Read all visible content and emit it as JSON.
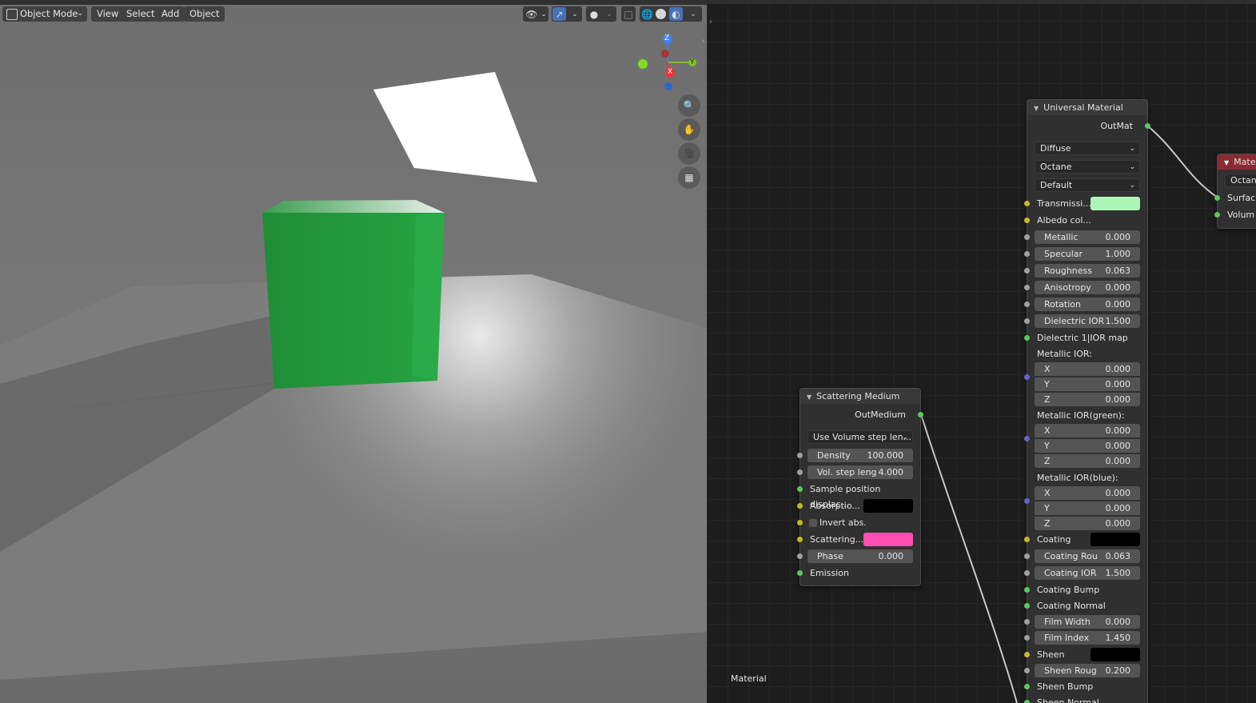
{
  "viewport": {
    "mode_label": "Object Mode",
    "menus": [
      "View",
      "Select",
      "Add",
      "Object"
    ],
    "gizmo": {
      "z": "Z",
      "y": "Y",
      "x": "X"
    }
  },
  "node_editor": {
    "frame_label": "Material",
    "universal": {
      "title": "Universal Material",
      "output": "OutMat",
      "dropdowns": [
        "Diffuse",
        "Octane",
        "Default"
      ],
      "transmission_label": "Transmissi...",
      "transmission_color": "#aef5b8",
      "albedo_label": "Albedo col...",
      "fields": [
        {
          "label": "Metallic",
          "value": "0.000"
        },
        {
          "label": "Specular",
          "value": "1.000"
        },
        {
          "label": "Roughness",
          "value": "0.063"
        },
        {
          "label": "Anisotropy",
          "value": "0.000"
        },
        {
          "label": "Rotation",
          "value": "0.000"
        },
        {
          "label": "Dielectric IOR",
          "value": "1.500"
        }
      ],
      "ior_map_label": "Dielectric 1|IOR map",
      "metallic_ior_label": "Metallic IOR:",
      "metallic_ior": [
        {
          "axis": "X",
          "value": "0.000"
        },
        {
          "axis": "Y",
          "value": "0.000"
        },
        {
          "axis": "Z",
          "value": "0.000"
        }
      ],
      "metallic_ior_green_label": "Metallic IOR(green):",
      "metallic_ior_green": [
        {
          "axis": "X",
          "value": "0.000"
        },
        {
          "axis": "Y",
          "value": "0.000"
        },
        {
          "axis": "Z",
          "value": "0.000"
        }
      ],
      "metallic_ior_blue_label": "Metallic IOR(blue):",
      "metallic_ior_blue": [
        {
          "axis": "X",
          "value": "0.000"
        },
        {
          "axis": "Y",
          "value": "0.000"
        },
        {
          "axis": "Z",
          "value": "0.000"
        }
      ],
      "coating_label": "Coating",
      "coating_fields": [
        {
          "label": "Coating Rou",
          "value": "0.063"
        },
        {
          "label": "Coating IOR",
          "value": "1.500"
        }
      ],
      "coating_bump_label": "Coating Bump",
      "coating_normal_label": "Coating Normal",
      "film_fields": [
        {
          "label": "Film Width",
          "value": "0.000"
        },
        {
          "label": "Film Index",
          "value": "1.450"
        }
      ],
      "sheen_label": "Sheen",
      "sheen_rough": {
        "label": "Sheen Roug",
        "value": "0.200"
      },
      "sheen_bump_label": "Sheen Bump",
      "sheen_normal_label": "Sheen Normal"
    },
    "scattering": {
      "title": "Scattering Medium",
      "output": "OutMedium",
      "dropdown": "Use Volume step len...",
      "density": {
        "label": "Density",
        "value": "100.000"
      },
      "vol_step": {
        "label": "Vol. step leng",
        "value": "4.000"
      },
      "sample_label": "Sample position displac...",
      "absorption_label": "Absorptio...",
      "invert_label": "Invert abs.",
      "scattering_label": "Scattering...",
      "scattering_color": "#ff4fb3",
      "phase": {
        "label": "Phase",
        "value": "0.000"
      },
      "emission_label": "Emission"
    },
    "material_out": {
      "title": "Mate",
      "dropdown": "Octan",
      "surface_label": "Surfac",
      "volume_label": "Volum"
    }
  }
}
